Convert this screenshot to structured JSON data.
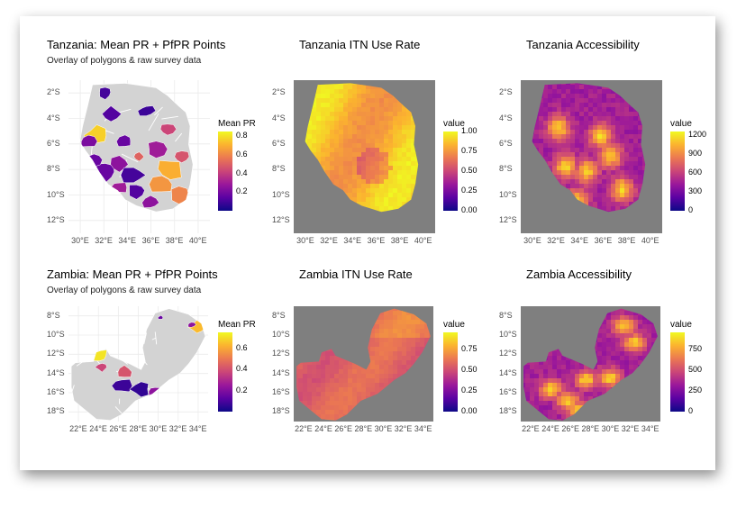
{
  "chart_data": [
    {
      "type": "heatmap",
      "title": "Tanzania: Mean PR + PfPR Points",
      "subtitle": "Overlay of polygons & raw survey data",
      "map": "tanzania",
      "style": "choropleth",
      "xticks": [
        "30°E",
        "32°E",
        "34°E",
        "36°E",
        "38°E",
        "40°E"
      ],
      "yticks": [
        "2°S",
        "4°S",
        "6°S",
        "8°S",
        "10°S",
        "12°S"
      ],
      "xlim": [
        29,
        41
      ],
      "ylim": [
        -12.5,
        -0.8
      ],
      "legend": {
        "title": "Mean PR",
        "palette": "plasma",
        "range": [
          0,
          0.85
        ],
        "ticks": [
          "0.8",
          "0.6",
          "0.4",
          "0.2"
        ],
        "tick_values": [
          0.8,
          0.6,
          0.4,
          0.2
        ]
      }
    },
    {
      "type": "heatmap",
      "title": "Tanzania ITN Use Rate",
      "map": "tanzania",
      "style": "raster-itn",
      "xticks": [
        "30°E",
        "32°E",
        "34°E",
        "36°E",
        "38°E",
        "40°E"
      ],
      "yticks": [
        "2°S",
        "4°S",
        "6°S",
        "8°S",
        "10°S",
        "12°S"
      ],
      "xlim": [
        29,
        41
      ],
      "ylim": [
        -12.5,
        -0.8
      ],
      "legend": {
        "title": "value",
        "palette": "plasma",
        "range": [
          0,
          1
        ],
        "ticks": [
          "1.00",
          "0.75",
          "0.50",
          "0.25",
          "0.00"
        ],
        "tick_values": [
          1,
          0.75,
          0.5,
          0.25,
          0
        ]
      }
    },
    {
      "type": "heatmap",
      "title": "Tanzania Accessibility",
      "map": "tanzania",
      "style": "raster-access",
      "xticks": [
        "30°E",
        "32°E",
        "34°E",
        "36°E",
        "38°E",
        "40°E"
      ],
      "yticks": [
        "2°S",
        "4°S",
        "6°S",
        "8°S",
        "10°S",
        "12°S"
      ],
      "xlim": [
        29,
        41
      ],
      "ylim": [
        -12.5,
        -0.8
      ],
      "legend": {
        "title": "value",
        "palette": "plasma",
        "range": [
          0,
          1250
        ],
        "ticks": [
          "1200",
          "900",
          "600",
          "300",
          "0"
        ],
        "tick_values": [
          1200,
          900,
          600,
          300,
          0
        ]
      }
    },
    {
      "type": "heatmap",
      "title": "Zambia: Mean PR + PfPR Points",
      "subtitle": "Overlay of polygons & raw survey data",
      "map": "zambia",
      "style": "choropleth",
      "xticks": [
        "22°E",
        "24°E",
        "26°E",
        "28°E",
        "30°E",
        "32°E",
        "34°E"
      ],
      "yticks": [
        "8°S",
        "10°S",
        "12°S",
        "14°S",
        "16°S",
        "18°S"
      ],
      "xlim": [
        21.5,
        34.2
      ],
      "ylim": [
        -18.2,
        -7.9
      ],
      "legend": {
        "title": "Mean PR",
        "palette": "plasma",
        "range": [
          0,
          0.75
        ],
        "ticks": [
          "0.6",
          "0.4",
          "0.2"
        ],
        "tick_values": [
          0.6,
          0.4,
          0.2
        ]
      }
    },
    {
      "type": "heatmap",
      "title": "Zambia ITN Use Rate",
      "map": "zambia",
      "style": "raster-itn",
      "xticks": [
        "22°E",
        "24°E",
        "26°E",
        "28°E",
        "30°E",
        "32°E",
        "34°E"
      ],
      "yticks": [
        "8°S",
        "10°S",
        "12°S",
        "14°S",
        "16°S",
        "18°S"
      ],
      "xlim": [
        21.5,
        34.2
      ],
      "ylim": [
        -18.2,
        -7.9
      ],
      "legend": {
        "title": "value",
        "palette": "plasma",
        "range": [
          0,
          0.95
        ],
        "ticks": [
          "0.75",
          "0.50",
          "0.25",
          "0.00"
        ],
        "tick_values": [
          0.75,
          0.5,
          0.25,
          0
        ]
      }
    },
    {
      "type": "heatmap",
      "title": "Zambia Accessibility",
      "map": "zambia",
      "style": "raster-access",
      "xticks": [
        "22°E",
        "24°E",
        "26°E",
        "28°E",
        "30°E",
        "32°E",
        "34°E"
      ],
      "yticks": [
        "8°S",
        "10°S",
        "12°S",
        "14°S",
        "16°S",
        "18°S"
      ],
      "xlim": [
        21.5,
        34.2
      ],
      "ylim": [
        -18.2,
        -7.9
      ],
      "legend": {
        "title": "value",
        "palette": "plasma",
        "range": [
          0,
          950
        ],
        "ticks": [
          "750",
          "500",
          "250",
          "0"
        ],
        "tick_values": [
          750,
          500,
          250,
          0
        ]
      }
    }
  ],
  "colors": {
    "plasma": [
      "#0d0887",
      "#5b02a3",
      "#9a179b",
      "#cb4678",
      "#eb7852",
      "#fbb32f",
      "#f0f921"
    ],
    "land_grey": "#d3d3d3",
    "nodata_grey": "#7f7f7f",
    "grid": "#ebebeb"
  }
}
